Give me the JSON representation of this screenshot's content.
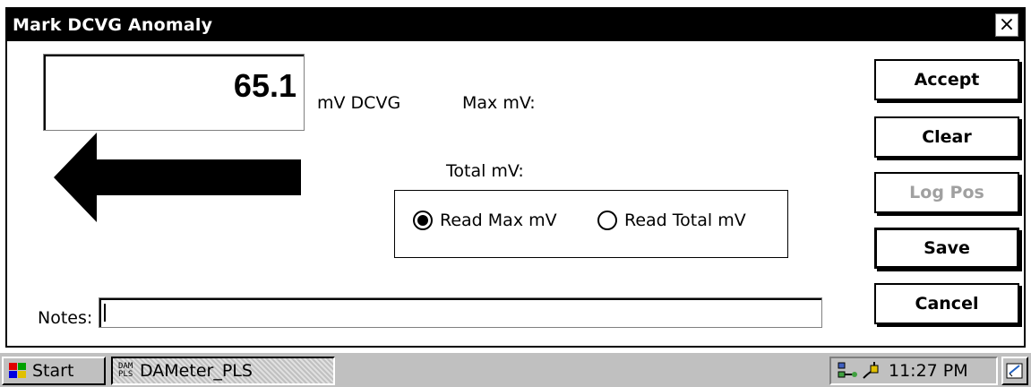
{
  "dialog": {
    "title": "Mark DCVG Anomaly",
    "close_glyph": "×",
    "reading_value": "65.1",
    "unit": "mV DCVG",
    "max_label": "Max mV:",
    "total_label": "Total mV:",
    "direction_icon": "left-arrow-icon",
    "radio_options": [
      {
        "label": "Read Max mV",
        "selected": true
      },
      {
        "label": "Read Total mV",
        "selected": false
      }
    ],
    "notes_label": "Notes:",
    "notes_value": ""
  },
  "buttons": {
    "accept": "Accept",
    "clear": "Clear",
    "log_pos": "Log Pos",
    "save": "Save",
    "cancel": "Cancel"
  },
  "taskbar": {
    "start_label": "Start",
    "task_icon_text": "DAM PLS",
    "task_label": "DAMeter_PLS",
    "clock": "11:27 PM"
  },
  "colors": {
    "titlebar": "#000000",
    "taskbar": "#c0c0c0",
    "disabled_text": "#a0a0a0"
  }
}
